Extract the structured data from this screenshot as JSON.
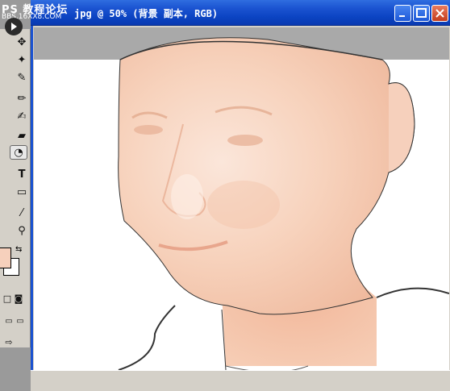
{
  "watermark": {
    "text": "PS 教程论坛",
    "sub": "BBS.16XX8.COM"
  },
  "window": {
    "title": "jpg @ 50% (背景 副本, RGB)"
  },
  "tools": [
    {
      "name": "move-tool-icon",
      "glyph": "✥"
    },
    {
      "name": "magic-wand-icon",
      "glyph": "✦"
    },
    {
      "name": "slice-tool-icon",
      "glyph": "✎"
    },
    {
      "name": "brush-tool-icon",
      "glyph": "✏"
    },
    {
      "name": "history-brush-icon",
      "glyph": "✍"
    },
    {
      "name": "gradient-tool-icon",
      "glyph": "■"
    },
    {
      "name": "path-tool-icon",
      "glyph": "◔"
    },
    {
      "name": "type-tool-icon",
      "glyph": "T"
    },
    {
      "name": "shape-tool-icon",
      "glyph": "□"
    },
    {
      "name": "eyedropper-icon",
      "glyph": "⁄"
    },
    {
      "name": "zoom-tool-icon",
      "glyph": "🔍"
    }
  ],
  "colors": {
    "titlebar": "#0b43c2",
    "foreground_swatch": "#f6d0bc",
    "background_swatch": "#ffffff",
    "skin": "#f6d0bc"
  }
}
